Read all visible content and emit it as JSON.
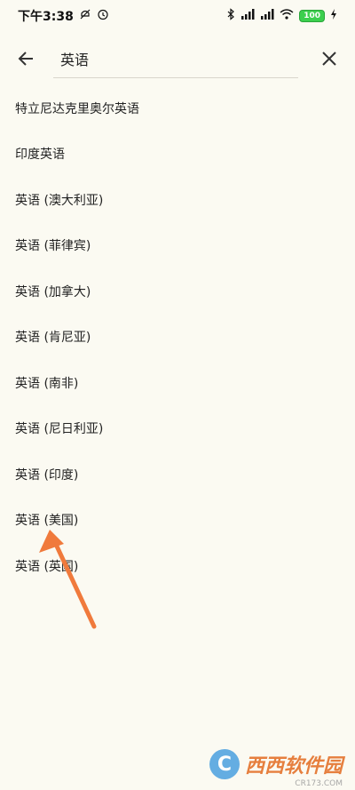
{
  "status_bar": {
    "time": "下午3:38",
    "battery": "100"
  },
  "search": {
    "value": "英语",
    "placeholder": ""
  },
  "languages": [
    "特立尼达克里奥尔英语",
    "印度英语",
    "英语 (澳大利亚)",
    "英语 (菲律宾)",
    "英语 (加拿大)",
    "英语 (肯尼亚)",
    "英语 (南非)",
    "英语 (尼日利亚)",
    "英语 (印度)",
    "英语 (美国)",
    "英语 (英国)"
  ],
  "annotation": {
    "arrow_color": "#f07a3c"
  },
  "watermark": {
    "logo": "C",
    "text": "西西软件园",
    "sub": "CR173.COM"
  },
  "colors": {
    "background": "#fbfaf2",
    "battery": "#3ccf4e"
  }
}
